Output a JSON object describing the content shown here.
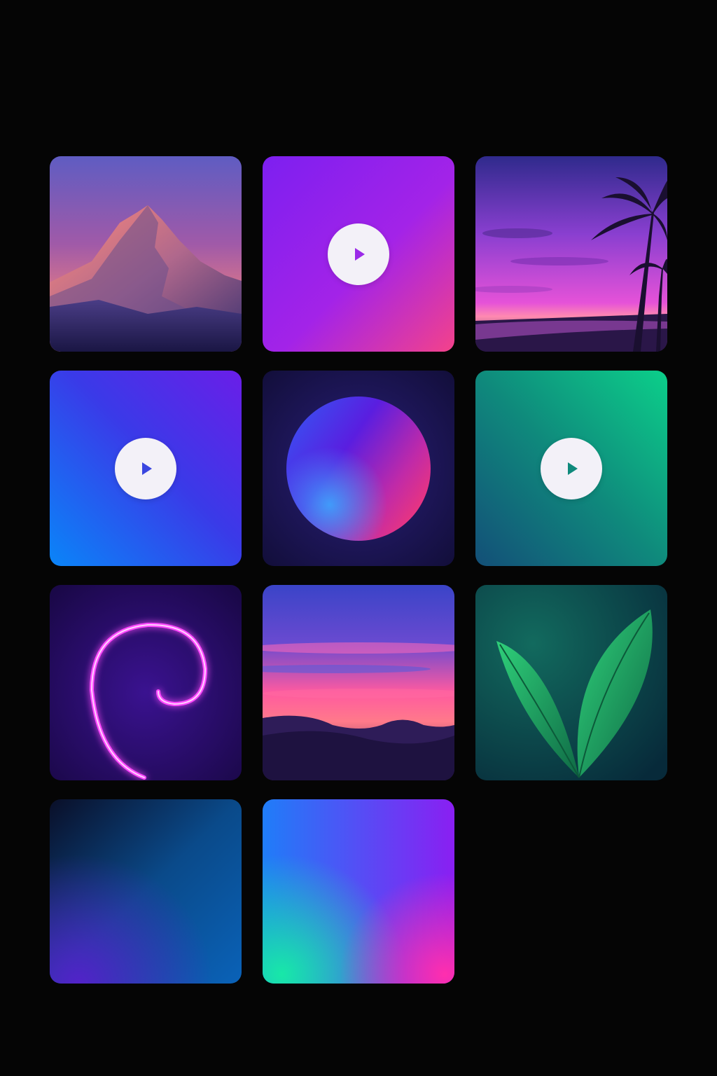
{
  "gallery": {
    "background": "#050505",
    "tiles": [
      {
        "kind": "image",
        "icon": "mountain-icon",
        "colors": [
          "#5b57b8",
          "#c95b86",
          "#2b1f55"
        ]
      },
      {
        "kind": "video",
        "icon": "play-icon",
        "colors": [
          "#8a1ff2",
          "#ee3f8d"
        ],
        "play_color": "#9b2ae8"
      },
      {
        "kind": "image",
        "icon": "palm-beach-icon",
        "colors": [
          "#3a2a8a",
          "#d13fd0",
          "#ff7bb0"
        ]
      },
      {
        "kind": "video",
        "icon": "play-icon",
        "colors": [
          "#0f7ff6",
          "#5a22e8"
        ],
        "play_color": "#3a46e0"
      },
      {
        "kind": "image",
        "icon": "orb-icon",
        "colors": [
          "#1a1550",
          "#6a1ee0",
          "#ff3a7a"
        ]
      },
      {
        "kind": "video",
        "icon": "play-icon",
        "colors": [
          "#0cc58a",
          "#125f78"
        ],
        "play_color": "#0f8a7c"
      },
      {
        "kind": "image",
        "icon": "neon-swirl-icon",
        "colors": [
          "#2a0a5c",
          "#ff45ff"
        ]
      },
      {
        "kind": "image",
        "icon": "sunset-hills-icon",
        "colors": [
          "#3a3fc0",
          "#ff5aa0",
          "#2a1540"
        ]
      },
      {
        "kind": "image",
        "icon": "leaf-icon",
        "colors": [
          "#0b3a4a",
          "#1fbf6e"
        ]
      },
      {
        "kind": "image",
        "icon": "gradient-icon",
        "colors": [
          "#0a1530",
          "#0a62b8",
          "#5a1ecf"
        ]
      },
      {
        "kind": "image",
        "icon": "gradient-icon",
        "colors": [
          "#1f7df8",
          "#18e0a8",
          "#ff2fae",
          "#8a1ff2"
        ]
      }
    ]
  }
}
